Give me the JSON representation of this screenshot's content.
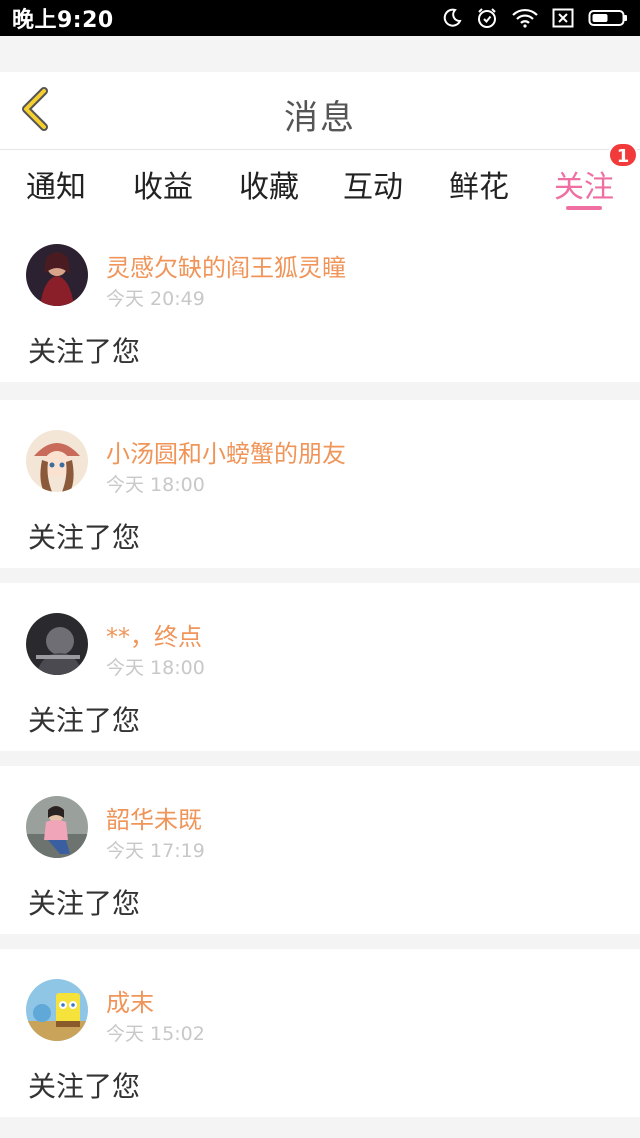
{
  "status_bar": {
    "time": "晚上9:20",
    "icons": [
      "moon-icon",
      "alarm-icon",
      "wifi-icon",
      "sim-off-icon",
      "battery-icon"
    ]
  },
  "header": {
    "title": "消息",
    "back_icon": "chevron-left-icon"
  },
  "tabs": [
    {
      "label": "通知",
      "active": false
    },
    {
      "label": "收益",
      "active": false
    },
    {
      "label": "收藏",
      "active": false
    },
    {
      "label": "互动",
      "active": false
    },
    {
      "label": "鲜花",
      "active": false
    },
    {
      "label": "关注",
      "active": true,
      "badge": "1"
    }
  ],
  "colors": {
    "accent": "#ef6fa3",
    "username": "#f0955a",
    "badge": "#f23a3a"
  },
  "items": [
    {
      "username": "灵感欠缺的阎王狐灵瞳",
      "time": "今天 20:49",
      "message": "关注了您"
    },
    {
      "username": "小汤圆和小螃蟹的朋友",
      "time": "今天 18:00",
      "message": "关注了您"
    },
    {
      "username": "**，终点",
      "time": "今天 18:00",
      "message": "关注了您"
    },
    {
      "username": "韶华未既",
      "time": "今天 17:19",
      "message": "关注了您"
    },
    {
      "username": "成末",
      "time": "今天 15:02",
      "message": "关注了您"
    }
  ]
}
